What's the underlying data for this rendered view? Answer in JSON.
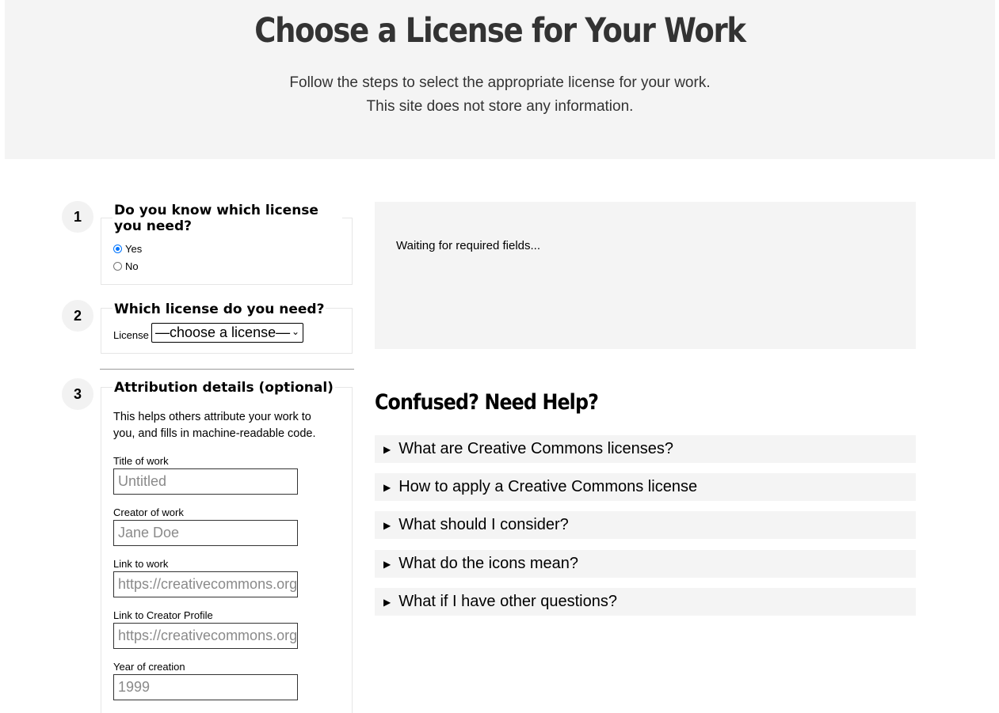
{
  "header": {
    "title": "Choose a License for Your Work",
    "subtitle_line1": "Follow the steps to select the appropriate license for your work.",
    "subtitle_line2": "This site does not store any information."
  },
  "steps": [
    {
      "number": "1",
      "legend": "Do you know which license you need?",
      "options": [
        {
          "label": "Yes",
          "checked": true
        },
        {
          "label": "No",
          "checked": false
        }
      ]
    },
    {
      "number": "2",
      "legend": "Which license do you need?",
      "select_label": "License",
      "select_value": "—choose a license—"
    },
    {
      "number": "3",
      "legend": "Attribution details (optional)",
      "help_line1": "This helps others attribute your work to",
      "help_line2": "you, and fills in machine-readable code.",
      "fields": [
        {
          "label": "Title of work",
          "placeholder": "Untitled"
        },
        {
          "label": "Creator of work",
          "placeholder": "Jane Doe"
        },
        {
          "label": "Link to work",
          "placeholder": "https://creativecommons.org"
        },
        {
          "label": "Link to Creator Profile",
          "placeholder": "https://creativecommons.org"
        },
        {
          "label": "Year of creation",
          "placeholder": "1999"
        }
      ]
    }
  ],
  "result": {
    "status": "Waiting for required fields..."
  },
  "help": {
    "heading": "Confused? Need Help?",
    "items": [
      "What are Creative Commons licenses?",
      "How to apply a Creative Commons license",
      "What should I consider?",
      "What do the icons mean?",
      "What if I have other questions?"
    ]
  }
}
